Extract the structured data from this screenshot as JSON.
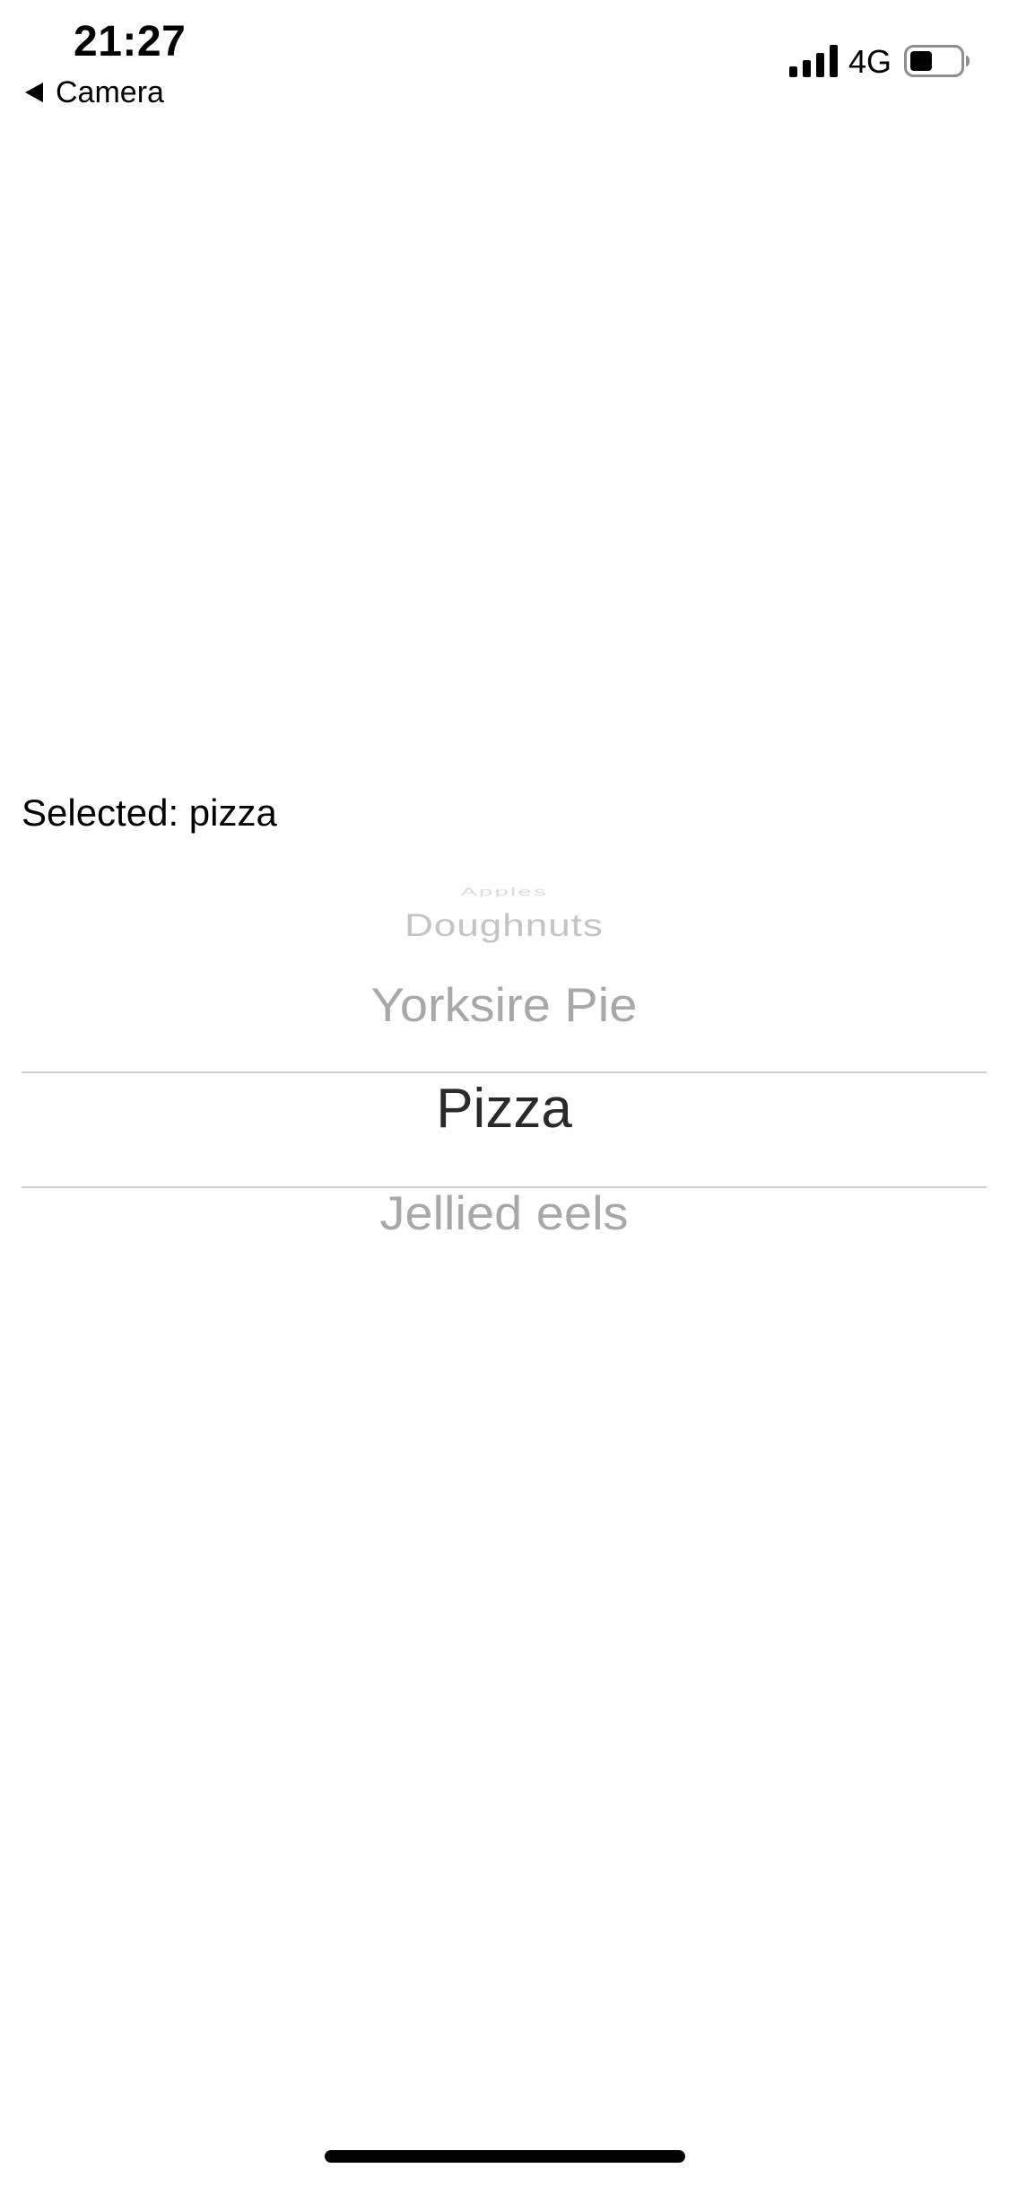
{
  "status_bar": {
    "time": "21:27",
    "back_label": "Camera",
    "network": "4G",
    "signal_bars": 4,
    "battery_level": 0.45
  },
  "selected_text": "Selected: pizza",
  "picker": {
    "items": [
      "Apples",
      "Doughnuts",
      "Yorksire Pie",
      "Pizza",
      "Jellied eels"
    ],
    "selected_index": 3
  },
  "icons": {
    "back": "back-arrow-icon",
    "signal": "cellular-signal-icon",
    "battery": "battery-icon"
  }
}
